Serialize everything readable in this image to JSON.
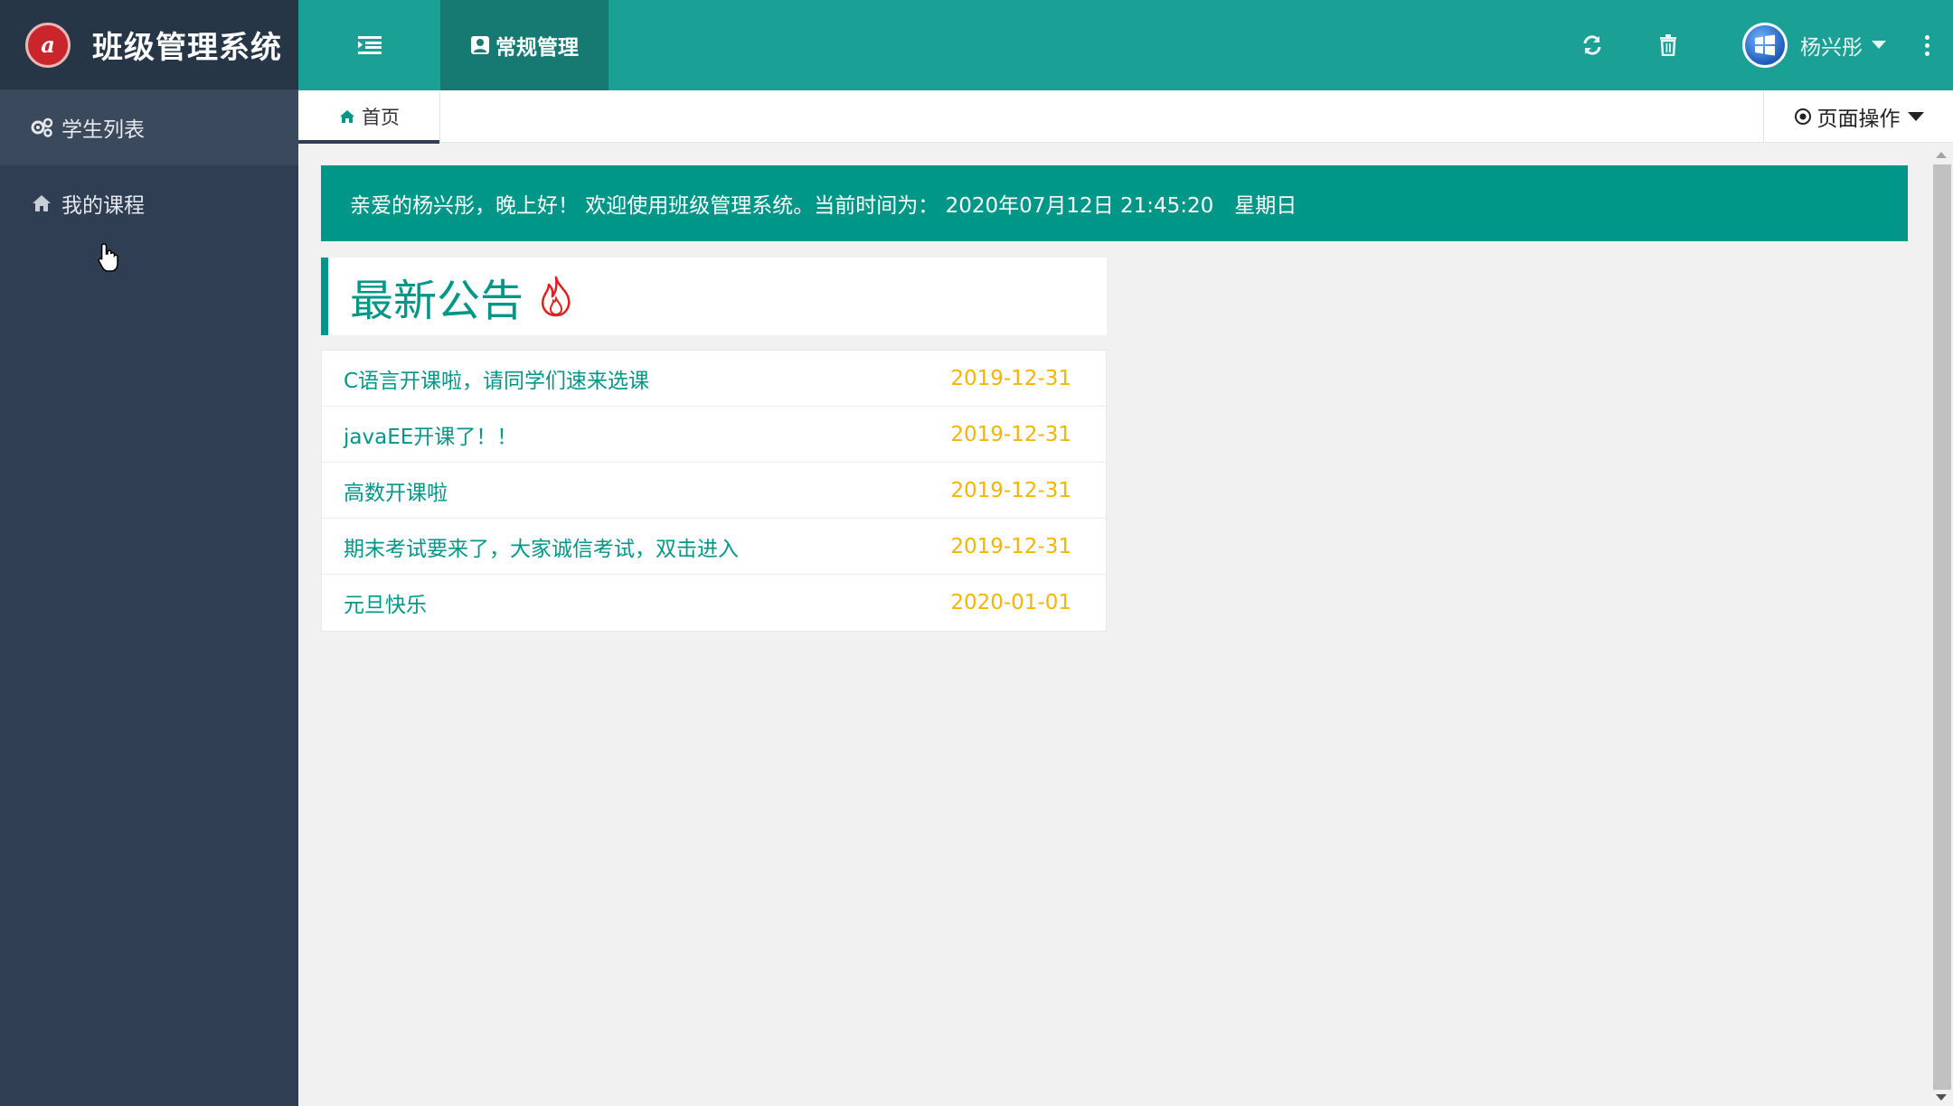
{
  "app": {
    "title": "班级管理系统",
    "logo_letter": "a"
  },
  "sidebar": {
    "items": [
      {
        "label": "学生列表",
        "icon": "gears-icon",
        "active": true
      },
      {
        "label": "我的课程",
        "icon": "home-icon",
        "active": false
      }
    ]
  },
  "header": {
    "menu_icon": "menu-indent-icon",
    "tab_label": "常规管理",
    "refresh_icon": "refresh-icon",
    "clear_icon": "trash-icon",
    "user_name": "杨兴彤",
    "more_icon": "more-vertical-icon"
  },
  "tabbar": {
    "home_label": "首页",
    "page_ops_label": "页面操作"
  },
  "welcome": {
    "text": "亲爱的杨兴彤，晚上好！ 欢迎使用班级管理系统。当前时间为： 2020年07月12日 21:45:20　星期日"
  },
  "notices": {
    "title": "最新公告",
    "items": [
      {
        "text": "C语言开课啦，请同学们速来选课",
        "date": "2019-12-31"
      },
      {
        "text": "javaEE开课了！！",
        "date": "2019-12-31"
      },
      {
        "text": "高数开课啦",
        "date": "2019-12-31"
      },
      {
        "text": "期末考试要来了，大家诚信考试，双击进入",
        "date": "2019-12-31"
      },
      {
        "text": "元旦快乐",
        "date": "2020-01-01"
      }
    ]
  },
  "colors": {
    "primary": "#009688",
    "header": "#1aa094",
    "sidebar": "#2f3e52",
    "date": "#f5b400",
    "flame": "#e02020"
  }
}
